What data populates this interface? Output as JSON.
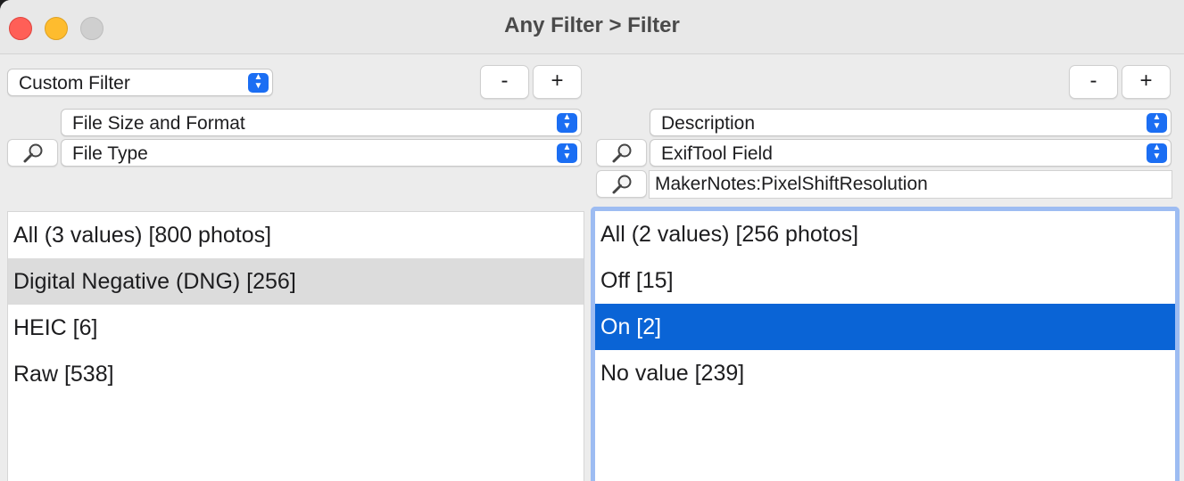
{
  "window": {
    "title": "Any Filter > Filter"
  },
  "left": {
    "preset": "Custom Filter",
    "minus_label": "-",
    "plus_label": "+",
    "category": "File Size and Format",
    "field": "File Type",
    "list": [
      {
        "label": "All (3 values) [800 photos]",
        "state": "normal"
      },
      {
        "label": "Digital Negative (DNG) [256]",
        "state": "selected-inactive"
      },
      {
        "label": "HEIC [6]",
        "state": "normal"
      },
      {
        "label": "Raw [538]",
        "state": "normal"
      }
    ]
  },
  "right": {
    "minus_label": "-",
    "plus_label": "+",
    "category": "Description",
    "field": "ExifTool Field",
    "tag_value": "MakerNotes:PixelShiftResolution",
    "list": [
      {
        "label": "All (2 values) [256 photos]",
        "state": "normal"
      },
      {
        "label": "Off [15]",
        "state": "normal"
      },
      {
        "label": "On [2]",
        "state": "selected-active"
      },
      {
        "label": "No value [239]",
        "state": "normal"
      }
    ]
  },
  "colors": {
    "accent": "#0a64d6",
    "focus_ring": "#9dbcf2",
    "close": "#ff5f57",
    "minimize": "#febc2e"
  },
  "icons": {
    "search": "magnifying-glass-icon",
    "popup": "chevron-up-down-icon"
  }
}
